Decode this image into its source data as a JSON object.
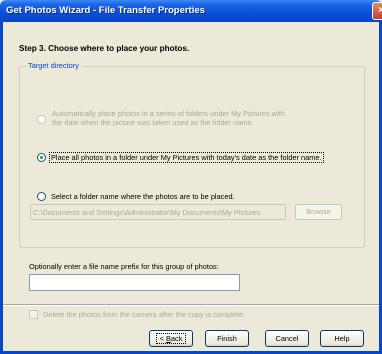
{
  "window": {
    "title": "Get Photos Wizard - File Transfer Properties",
    "close_glyph": "×"
  },
  "step_title": "Step 3. Choose where to place your photos.",
  "target_directory": {
    "legend": "Target directory",
    "options": [
      {
        "line1": "Automatically place photos in a series of folders under My Pictures with",
        "line2": "the date when the picture was taken used as the folder name.",
        "enabled": false,
        "checked": false
      },
      {
        "label": "Place all photos in a folder under My Pictures with today's date as the folder name.",
        "enabled": true,
        "checked": true
      },
      {
        "label": "Select a folder name where the photos are to be placed.",
        "enabled": true,
        "checked": false
      }
    ],
    "folder_path": "C:\\Documents and Settings\\Administrator\\My Documents\\My Pictures",
    "browse_label": "Browse"
  },
  "prefix": {
    "label": "Optionally enter a file name prefix for this group of photos:",
    "value": ""
  },
  "delete_option": {
    "label": "Delete the photos from the camera after the copy is complete.",
    "checked": false,
    "enabled": false
  },
  "buttons": {
    "back_prefix": "< ",
    "back_key": "B",
    "back_rest": "ack",
    "finish": "Finish",
    "cancel": "Cancel",
    "help": "Help"
  }
}
